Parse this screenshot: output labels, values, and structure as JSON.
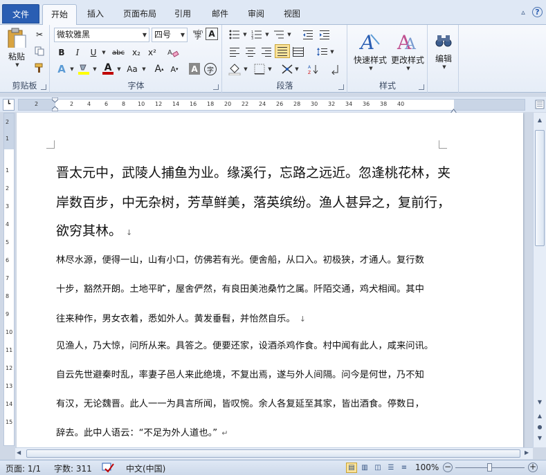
{
  "tabs": [
    "文件",
    "开始",
    "插入",
    "页面布局",
    "引用",
    "邮件",
    "审阅",
    "视图"
  ],
  "window": {
    "help_label": "?"
  },
  "clipboard": {
    "paste_label": "粘贴",
    "group_label": "剪贴板"
  },
  "font": {
    "name": "微软雅黑",
    "size": "四号",
    "group_label": "字体",
    "btn_bold": "B",
    "btn_italic": "I",
    "btn_underline": "U",
    "btn_strike": "abc",
    "btn_sub": "x₂",
    "btn_sup": "x²",
    "btn_aa": "Aa",
    "btn_a": "A",
    "btn_grow": "A",
    "btn_shrink": "A",
    "btn_wen": "wén",
    "btn_char": "字"
  },
  "paragraph": {
    "group_label": "段落"
  },
  "styles": {
    "quick_label": "快速样式",
    "change_label": "更改样式",
    "group_label": "样式"
  },
  "editing": {
    "label": "编辑"
  },
  "ruler": {
    "h_ticks": [
      "2",
      "2",
      "4",
      "6",
      "8",
      "10",
      "12",
      "14",
      "16",
      "18",
      "20",
      "22",
      "24",
      "26",
      "28",
      "30",
      "32",
      "34",
      "36",
      "38",
      "40"
    ],
    "v_ticks": [
      "2",
      "1",
      "1",
      "2",
      "3",
      "4",
      "5",
      "6",
      "7",
      "8",
      "9",
      "10",
      "11",
      "12",
      "13",
      "14",
      "15"
    ]
  },
  "document": {
    "p1": [
      "晋太元中，武陵人捕鱼为业。缘溪行，忘路之远近。忽逢桃花林，夹",
      "岸数百步，中无杂树，芳草鲜美，落英缤纷。渔人甚异之，复前行，",
      "欲穷其林。"
    ],
    "p2": [
      "林尽水源，便得一山，山有小口，仿佛若有光。便舍船，从口入。初极狭，才通人。复行数",
      "十步，豁然开朗。土地平旷，屋舍俨然，有良田美池桑竹之属。阡陌交通，鸡犬相闻。其中",
      "往来种作，男女衣着，悉如外人。黄发垂髫，并怡然自乐。"
    ],
    "p3": [
      "见渔人，乃大惊，问所从来。具答之。便要还家，设酒杀鸡作食。村中闻有此人，咸来问讯。",
      "自云先世避秦时乱，率妻子邑人来此绝境，不复出焉，遂与外人间隔。问今是何世，乃不知",
      "有汉，无论魏晋。此人一一为具言所闻，皆叹惋。余人各复延至其家，皆出酒食。停数日，",
      "辞去。此中人语云：“不足为外人道也。”"
    ],
    "para_mark": "↓",
    "para_mark_end": "↵"
  },
  "status": {
    "page": "页面: 1/1",
    "words": "字数: 311",
    "language": "中文(中国)",
    "zoom": "100%",
    "zoom_value": 100
  },
  "colors": {
    "file_tab": "#2a5eb3",
    "ribbon": "#f7f9fd",
    "highlight": "#fbe39a"
  }
}
